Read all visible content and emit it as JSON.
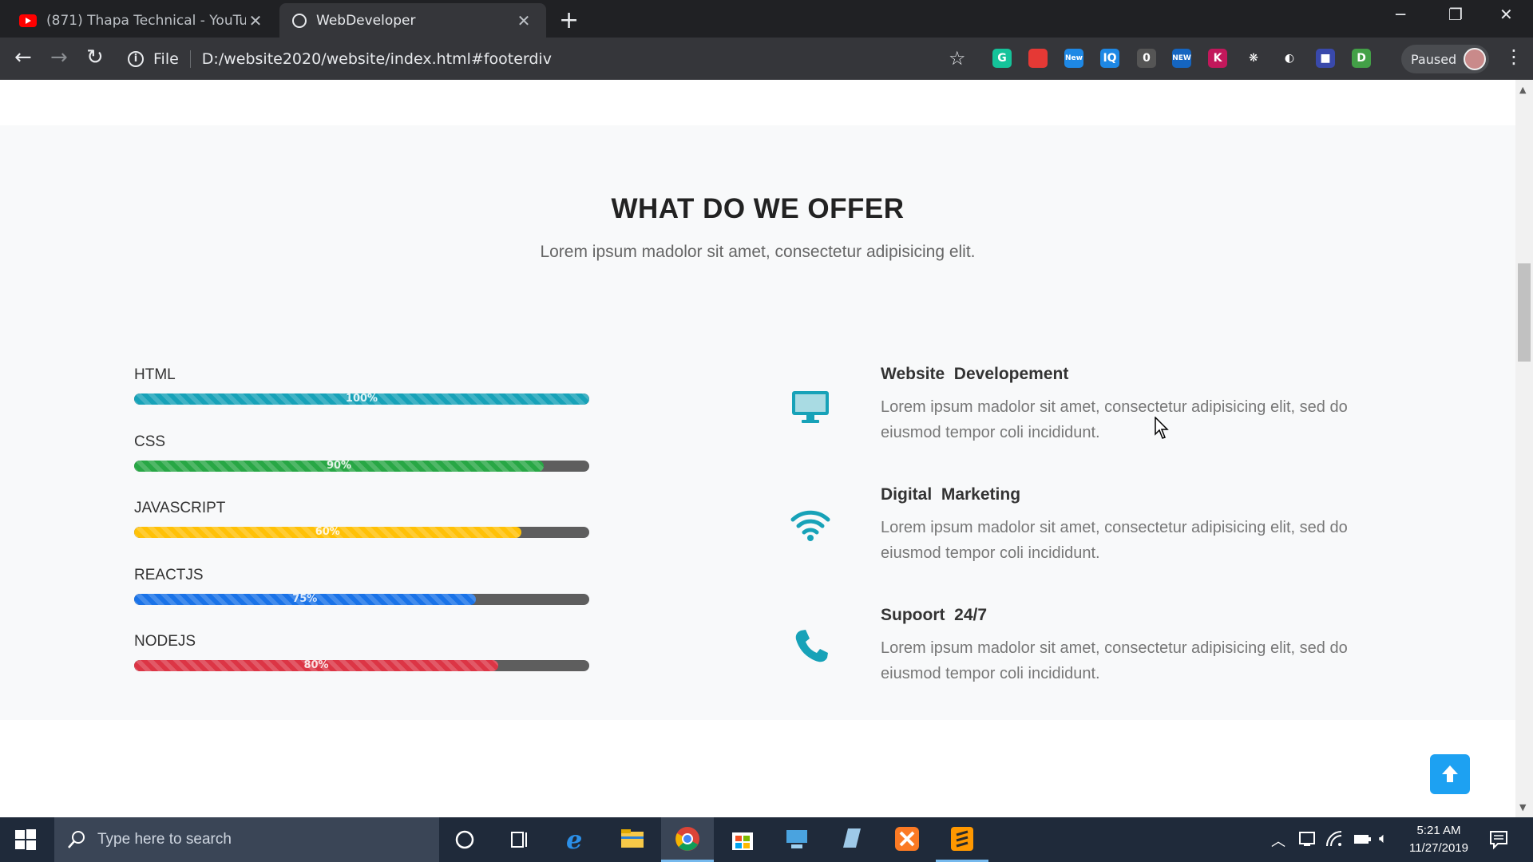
{
  "browser": {
    "tabs": [
      {
        "title": "(871) Thapa Technical - YouTube",
        "active": false
      },
      {
        "title": "WebDeveloper",
        "active": true
      }
    ],
    "address": {
      "scheme_label": "File",
      "url": "D:/website2020/website/index.html#footerdiv"
    },
    "extensions": [
      {
        "name": "grammarly-icon",
        "label": "G",
        "color": "#15c39a"
      },
      {
        "name": "red-bookmark-icon",
        "label": "",
        "color": "#e53935"
      },
      {
        "name": "new-badge-icon",
        "label": "New",
        "color": "#1e88e5"
      },
      {
        "name": "iq-icon",
        "label": "IQ",
        "color": "#1e88e5"
      },
      {
        "name": "counter-icon",
        "label": "0",
        "color": "#555555"
      },
      {
        "name": "new-ext-icon",
        "label": "NEW",
        "color": "#1565c0"
      },
      {
        "name": "k-icon",
        "label": "K",
        "color": "#c2185b"
      },
      {
        "name": "gear-ext-icon",
        "label": "❋",
        "color": "#35363a"
      },
      {
        "name": "compass-ext-icon",
        "label": "◐",
        "color": "#35363a"
      },
      {
        "name": "blue-square-icon",
        "label": "■",
        "color": "#3949ab"
      },
      {
        "name": "d-icon",
        "label": "D",
        "color": "#43a047"
      }
    ],
    "profile_status": "Paused"
  },
  "section": {
    "title": "WHAT DO WE OFFER",
    "subtitle": "Lorem ipsum madolor sit amet, consectetur adipisicing elit."
  },
  "skills": [
    {
      "label": "HTML",
      "value": 1.0,
      "percent_text": "100%",
      "color": "#17a2b8"
    },
    {
      "label": "CSS",
      "value": 0.9,
      "percent_text": "90%",
      "color": "#28a745"
    },
    {
      "label": "JAVASCRIPT",
      "value": 0.85,
      "percent_text": "60%",
      "color": "#ffc107"
    },
    {
      "label": "REACTJS",
      "value": 0.75,
      "percent_text": "75%",
      "color": "#1a73e8"
    },
    {
      "label": "NODEJS",
      "value": 0.8,
      "percent_text": "80%",
      "color": "#dc3545"
    }
  ],
  "services": [
    {
      "icon": "monitor-icon",
      "title": "Website  Developement",
      "text": "Lorem ipsum madolor sit amet, consectetur adipisicing elit, sed do eiusmod tempor coli incididunt."
    },
    {
      "icon": "wifi-icon",
      "title": "Digital  Marketing",
      "text": "Lorem ipsum madolor sit amet, consectetur adipisicing elit, sed do eiusmod tempor coli incididunt."
    },
    {
      "icon": "phone-icon",
      "title": "Supoort  24/7",
      "text": "Lorem ipsum madolor sit amet, consectetur adipisicing elit, sed do eiusmod tempor coli incididunt."
    }
  ],
  "accent_color": "#17a2b8",
  "taskbar": {
    "search_placeholder": "Type here to search",
    "time": "5:21 AM",
    "date": "11/27/2019"
  }
}
